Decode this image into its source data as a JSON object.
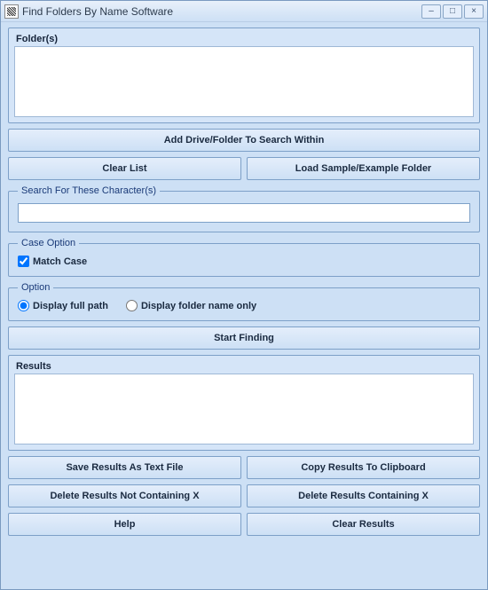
{
  "window": {
    "title": "Find Folders By Name Software"
  },
  "folders": {
    "label": "Folder(s)"
  },
  "buttons": {
    "addDrive": "Add Drive/Folder To Search Within",
    "clearList": "Clear List",
    "loadSample": "Load Sample/Example Folder",
    "startFinding": "Start Finding",
    "saveResults": "Save Results As Text File",
    "copyResults": "Copy Results To Clipboard",
    "deleteNotContaining": "Delete Results Not Containing X",
    "deleteContaining": "Delete Results Containing X",
    "help": "Help",
    "clearResults": "Clear Results"
  },
  "search": {
    "legend": "Search For These Character(s)",
    "value": ""
  },
  "caseOption": {
    "legend": "Case Option",
    "matchCaseLabel": "Match Case",
    "matchCaseChecked": true
  },
  "option": {
    "legend": "Option",
    "fullPathLabel": "Display full path",
    "nameOnlyLabel": "Display folder name only",
    "selected": "fullPath"
  },
  "results": {
    "label": "Results"
  }
}
